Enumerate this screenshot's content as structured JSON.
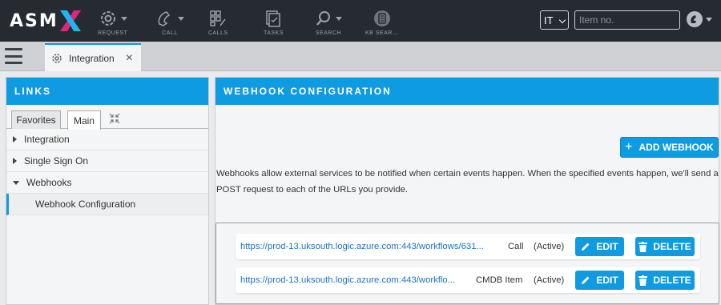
{
  "app": {
    "logo_text": "ASM"
  },
  "nav": {
    "request": "REQUEST",
    "call": "CALL",
    "calls": "CALLS",
    "tasks": "TASKS",
    "search": "SEARCH",
    "kb_search": "KB SEAR..."
  },
  "header": {
    "department_selected": "IT",
    "item_placeholder": "Item no."
  },
  "tab": {
    "label": "Integration",
    "close_glyph": "×"
  },
  "links": {
    "title": "LINKS",
    "subtabs": [
      "Favorites",
      "Main"
    ],
    "tree": [
      {
        "label": "Integration"
      },
      {
        "label": "Single Sign On"
      },
      {
        "label": "Webhooks"
      }
    ],
    "selected_child": "Webhook Configuration"
  },
  "webhook": {
    "title": "WEBHOOK CONFIGURATION",
    "add_label": "ADD WEBHOOK",
    "description": "Webhooks allow external services to be notified when certain events happen. When the specified events happen, we'll send a POST request to each of the URLs you provide.",
    "rows": [
      {
        "url": "https://prod-13.uksouth.logic.azure.com:443/workflows/631...",
        "type": "Call",
        "status": "(Active)"
      },
      {
        "url": "https://prod-13.uksouth.logic.azure.com:443/workflo...",
        "type": "CMDB Item",
        "status": "(Active)"
      }
    ],
    "edit_label": "EDIT",
    "delete_label": "DELETE"
  },
  "colors": {
    "accent": "#0f9be2",
    "topbar": "#262a31",
    "link": "#1a73c9"
  }
}
